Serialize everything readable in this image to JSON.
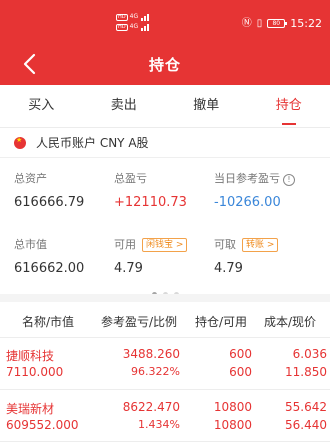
{
  "status_bar": {
    "hd1": "HD",
    "sig1": "4G",
    "hd2": "HD",
    "sig2": "4G",
    "nfc_icon": "nfc-icon",
    "vibrate_icon": "vibrate-icon",
    "battery": "80",
    "time": "15:22"
  },
  "header": {
    "back_icon": "chevron-left-icon",
    "title": "持仓"
  },
  "tabs": [
    {
      "label": "买入",
      "active": false
    },
    {
      "label": "卖出",
      "active": false
    },
    {
      "label": "撤单",
      "active": false
    },
    {
      "label": "持仓",
      "active": true
    }
  ],
  "account": {
    "flag_icon": "china-flag-icon",
    "label": "人民币账户 CNY A股"
  },
  "summary": {
    "total_assets_label": "总资产",
    "total_assets_value": "616666.79",
    "total_pl_label": "总盈亏",
    "total_pl_value": "+12110.73",
    "today_pl_label": "当日参考盈亏",
    "today_pl_value": "-10266.00",
    "market_value_label": "总市值",
    "market_value_value": "616662.00",
    "available_label": "可用",
    "available_chip": "闲钱宝 >",
    "available_value": "4.79",
    "withdrawable_label": "可取",
    "withdrawable_chip": "转账 >",
    "withdrawable_value": "4.79"
  },
  "colors": {
    "brand_red": "#e63434",
    "negative_blue": "#3a86d9",
    "chip_orange": "#ef8b1f"
  },
  "table": {
    "headers": [
      "名称/市值",
      "参考盈亏/比例",
      "持仓/可用",
      "成本/现价"
    ],
    "rows": [
      {
        "name": "捷顺科技",
        "market_value": "7110.000",
        "pl": "3488.260",
        "pl_ratio": "96.322%",
        "position": "600",
        "available": "600",
        "cost": "6.036",
        "price": "11.850"
      },
      {
        "name": "美瑞新材",
        "market_value": "609552.000",
        "pl": "8622.470",
        "pl_ratio": "1.434%",
        "position": "10800",
        "available": "10800",
        "cost": "55.642",
        "price": "56.440"
      }
    ]
  }
}
